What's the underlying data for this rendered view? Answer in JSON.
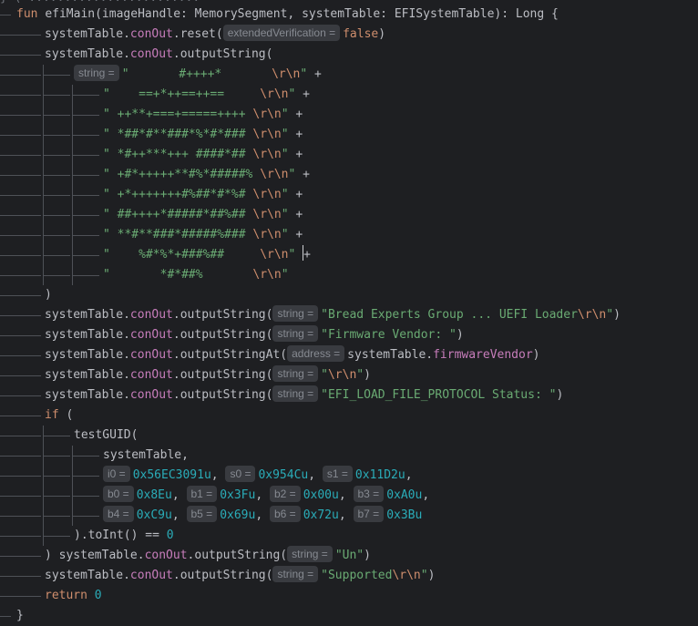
{
  "editor": {
    "top_fragment": "} ( ........................                  ",
    "lines": [
      {
        "indent": 0,
        "tokens": [
          {
            "t": "kw",
            "v": "fun"
          },
          {
            "t": "ws",
            "v": " "
          },
          {
            "t": "fn",
            "v": "efiMain"
          },
          {
            "t": "pl",
            "v": "(imageHandle: MemorySegment, systemTable: EFISystemTable): Long {"
          }
        ]
      },
      {
        "indent": 1,
        "tokens": [
          {
            "t": "pl",
            "v": "systemTable."
          },
          {
            "t": "prop",
            "v": "conOut"
          },
          {
            "t": "pl",
            "v": ".reset("
          },
          {
            "t": "hint",
            "v": "extendedVerification ="
          },
          {
            "t": "kw",
            "v": "false"
          },
          {
            "t": "pl",
            "v": ")"
          }
        ]
      },
      {
        "indent": 1,
        "tokens": [
          {
            "t": "pl",
            "v": "systemTable."
          },
          {
            "t": "prop",
            "v": "conOut"
          },
          {
            "t": "pl",
            "v": ".outputString("
          }
        ]
      },
      {
        "indent": 2,
        "tokens": [
          {
            "t": "hint",
            "v": "string ="
          },
          {
            "t": "str",
            "v": "\"       #++++*       "
          },
          {
            "t": "esc",
            "v": "\\r\\n"
          },
          {
            "t": "str",
            "v": "\""
          },
          {
            "t": "pl",
            "v": " +"
          }
        ]
      },
      {
        "indent": 3,
        "tokens": [
          {
            "t": "str",
            "v": "\"    ==+*++==++==     "
          },
          {
            "t": "esc",
            "v": "\\r\\n"
          },
          {
            "t": "str",
            "v": "\""
          },
          {
            "t": "pl",
            "v": " +"
          }
        ]
      },
      {
        "indent": 3,
        "tokens": [
          {
            "t": "str",
            "v": "\" ++**+===+=====++++ "
          },
          {
            "t": "esc",
            "v": "\\r\\n"
          },
          {
            "t": "str",
            "v": "\""
          },
          {
            "t": "pl",
            "v": " +"
          }
        ]
      },
      {
        "indent": 3,
        "tokens": [
          {
            "t": "str",
            "v": "\" *##*#**###*%*#*### "
          },
          {
            "t": "esc",
            "v": "\\r\\n"
          },
          {
            "t": "str",
            "v": "\""
          },
          {
            "t": "pl",
            "v": " +"
          }
        ]
      },
      {
        "indent": 3,
        "tokens": [
          {
            "t": "str",
            "v": "\" *#++***+++ ####*## "
          },
          {
            "t": "esc",
            "v": "\\r\\n"
          },
          {
            "t": "str",
            "v": "\""
          },
          {
            "t": "pl",
            "v": " +"
          }
        ]
      },
      {
        "indent": 3,
        "tokens": [
          {
            "t": "str",
            "v": "\" +#*+++++**#%*#####% "
          },
          {
            "t": "esc",
            "v": "\\r\\n"
          },
          {
            "t": "str",
            "v": "\""
          },
          {
            "t": "pl",
            "v": " +"
          }
        ]
      },
      {
        "indent": 3,
        "tokens": [
          {
            "t": "str",
            "v": "\" +*+++++++#%##*#*%# "
          },
          {
            "t": "esc",
            "v": "\\r\\n"
          },
          {
            "t": "str",
            "v": "\""
          },
          {
            "t": "pl",
            "v": " +"
          }
        ]
      },
      {
        "indent": 3,
        "tokens": [
          {
            "t": "str",
            "v": "\" ##++++*#####*##%## "
          },
          {
            "t": "esc",
            "v": "\\r\\n"
          },
          {
            "t": "str",
            "v": "\""
          },
          {
            "t": "pl",
            "v": " +"
          }
        ]
      },
      {
        "indent": 3,
        "tokens": [
          {
            "t": "str",
            "v": "\" **#**###*#####%### "
          },
          {
            "t": "esc",
            "v": "\\r\\n"
          },
          {
            "t": "str",
            "v": "\""
          },
          {
            "t": "pl",
            "v": " +"
          }
        ]
      },
      {
        "indent": 3,
        "caret": true,
        "tokens": [
          {
            "t": "str",
            "v": "\"    %#*%*+###%##     "
          },
          {
            "t": "esc",
            "v": "\\r\\n"
          },
          {
            "t": "str",
            "v": "\""
          },
          {
            "t": "pl",
            "v": " +"
          }
        ]
      },
      {
        "indent": 3,
        "tokens": [
          {
            "t": "str",
            "v": "\"       *#*##%       "
          },
          {
            "t": "esc",
            "v": "\\r\\n"
          },
          {
            "t": "str",
            "v": "\""
          }
        ]
      },
      {
        "indent": 1,
        "tokens": [
          {
            "t": "pl",
            "v": ")"
          }
        ]
      },
      {
        "indent": 1,
        "tokens": [
          {
            "t": "pl",
            "v": "systemTable."
          },
          {
            "t": "prop",
            "v": "conOut"
          },
          {
            "t": "pl",
            "v": ".outputString("
          },
          {
            "t": "hint",
            "v": "string ="
          },
          {
            "t": "str",
            "v": "\"Bread Experts Group ... UEFI Loader"
          },
          {
            "t": "esc",
            "v": "\\r\\n"
          },
          {
            "t": "str",
            "v": "\""
          },
          {
            "t": "pl",
            "v": ")"
          }
        ]
      },
      {
        "indent": 1,
        "tokens": [
          {
            "t": "pl",
            "v": "systemTable."
          },
          {
            "t": "prop",
            "v": "conOut"
          },
          {
            "t": "pl",
            "v": ".outputString("
          },
          {
            "t": "hint",
            "v": "string ="
          },
          {
            "t": "str",
            "v": "\"Firmware Vendor: \""
          },
          {
            "t": "pl",
            "v": ")"
          }
        ]
      },
      {
        "indent": 1,
        "tokens": [
          {
            "t": "pl",
            "v": "systemTable."
          },
          {
            "t": "prop",
            "v": "conOut"
          },
          {
            "t": "pl",
            "v": ".outputStringAt("
          },
          {
            "t": "hint",
            "v": "address ="
          },
          {
            "t": "pl",
            "v": "systemTable."
          },
          {
            "t": "prop",
            "v": "firmwareVendor"
          },
          {
            "t": "pl",
            "v": ")"
          }
        ]
      },
      {
        "indent": 1,
        "tokens": [
          {
            "t": "pl",
            "v": "systemTable."
          },
          {
            "t": "prop",
            "v": "conOut"
          },
          {
            "t": "pl",
            "v": ".outputString("
          },
          {
            "t": "hint",
            "v": "string ="
          },
          {
            "t": "str",
            "v": "\""
          },
          {
            "t": "esc",
            "v": "\\r\\n"
          },
          {
            "t": "str",
            "v": "\""
          },
          {
            "t": "pl",
            "v": ")"
          }
        ]
      },
      {
        "indent": 1,
        "tokens": [
          {
            "t": "pl",
            "v": "systemTable."
          },
          {
            "t": "prop",
            "v": "conOut"
          },
          {
            "t": "pl",
            "v": ".outputString("
          },
          {
            "t": "hint",
            "v": "string ="
          },
          {
            "t": "str",
            "v": "\"EFI_LOAD_FILE_PROTOCOL Status: \""
          },
          {
            "t": "pl",
            "v": ")"
          }
        ]
      },
      {
        "indent": 1,
        "tokens": [
          {
            "t": "kw",
            "v": "if"
          },
          {
            "t": "pl",
            "v": " ("
          }
        ]
      },
      {
        "indent": 2,
        "tokens": [
          {
            "t": "fn",
            "v": "testGUID"
          },
          {
            "t": "pl",
            "v": "("
          }
        ]
      },
      {
        "indent": 3,
        "tokens": [
          {
            "t": "pl",
            "v": "systemTable,"
          }
        ]
      },
      {
        "indent": 3,
        "tokens": [
          {
            "t": "hint",
            "v": "i0 ="
          },
          {
            "t": "num",
            "v": "0x56EC3091u"
          },
          {
            "t": "pl",
            "v": ", "
          },
          {
            "t": "hint",
            "v": "s0 ="
          },
          {
            "t": "num",
            "v": "0x954Cu"
          },
          {
            "t": "pl",
            "v": ", "
          },
          {
            "t": "hint",
            "v": "s1 ="
          },
          {
            "t": "num",
            "v": "0x11D2u"
          },
          {
            "t": "pl",
            "v": ","
          }
        ]
      },
      {
        "indent": 3,
        "tokens": [
          {
            "t": "hint",
            "v": "b0 ="
          },
          {
            "t": "num",
            "v": "0x8Eu"
          },
          {
            "t": "pl",
            "v": ", "
          },
          {
            "t": "hint",
            "v": "b1 ="
          },
          {
            "t": "num",
            "v": "0x3Fu"
          },
          {
            "t": "pl",
            "v": ", "
          },
          {
            "t": "hint",
            "v": "b2 ="
          },
          {
            "t": "num",
            "v": "0x00u"
          },
          {
            "t": "pl",
            "v": ", "
          },
          {
            "t": "hint",
            "v": "b3 ="
          },
          {
            "t": "num",
            "v": "0xA0u"
          },
          {
            "t": "pl",
            "v": ","
          }
        ]
      },
      {
        "indent": 3,
        "tokens": [
          {
            "t": "hint",
            "v": "b4 ="
          },
          {
            "t": "num",
            "v": "0xC9u"
          },
          {
            "t": "pl",
            "v": ", "
          },
          {
            "t": "hint",
            "v": "b5 ="
          },
          {
            "t": "num",
            "v": "0x69u"
          },
          {
            "t": "pl",
            "v": ", "
          },
          {
            "t": "hint",
            "v": "b6 ="
          },
          {
            "t": "num",
            "v": "0x72u"
          },
          {
            "t": "pl",
            "v": ", "
          },
          {
            "t": "hint",
            "v": "b7 ="
          },
          {
            "t": "num",
            "v": "0x3Bu"
          }
        ]
      },
      {
        "indent": 2,
        "tokens": [
          {
            "t": "pl",
            "v": ").toInt() == "
          },
          {
            "t": "num",
            "v": "0"
          }
        ]
      },
      {
        "indent": 1,
        "tokens": [
          {
            "t": "pl",
            "v": ") systemTable."
          },
          {
            "t": "prop",
            "v": "conOut"
          },
          {
            "t": "pl",
            "v": ".outputString("
          },
          {
            "t": "hint",
            "v": "string ="
          },
          {
            "t": "str",
            "v": "\"Un\""
          },
          {
            "t": "pl",
            "v": ")"
          }
        ]
      },
      {
        "indent": 1,
        "tokens": [
          {
            "t": "pl",
            "v": "systemTable."
          },
          {
            "t": "prop",
            "v": "conOut"
          },
          {
            "t": "pl",
            "v": ".outputString("
          },
          {
            "t": "hint",
            "v": "string ="
          },
          {
            "t": "str",
            "v": "\"Supported"
          },
          {
            "t": "esc",
            "v": "\\r\\n"
          },
          {
            "t": "str",
            "v": "\""
          },
          {
            "t": "pl",
            "v": ")"
          }
        ]
      },
      {
        "indent": 1,
        "tokens": [
          {
            "t": "kw",
            "v": "return"
          },
          {
            "t": "pl",
            "v": " "
          },
          {
            "t": "num",
            "v": "0"
          }
        ]
      },
      {
        "indent": 0,
        "tokens": [
          {
            "t": "pl",
            "v": "}"
          }
        ]
      }
    ]
  }
}
